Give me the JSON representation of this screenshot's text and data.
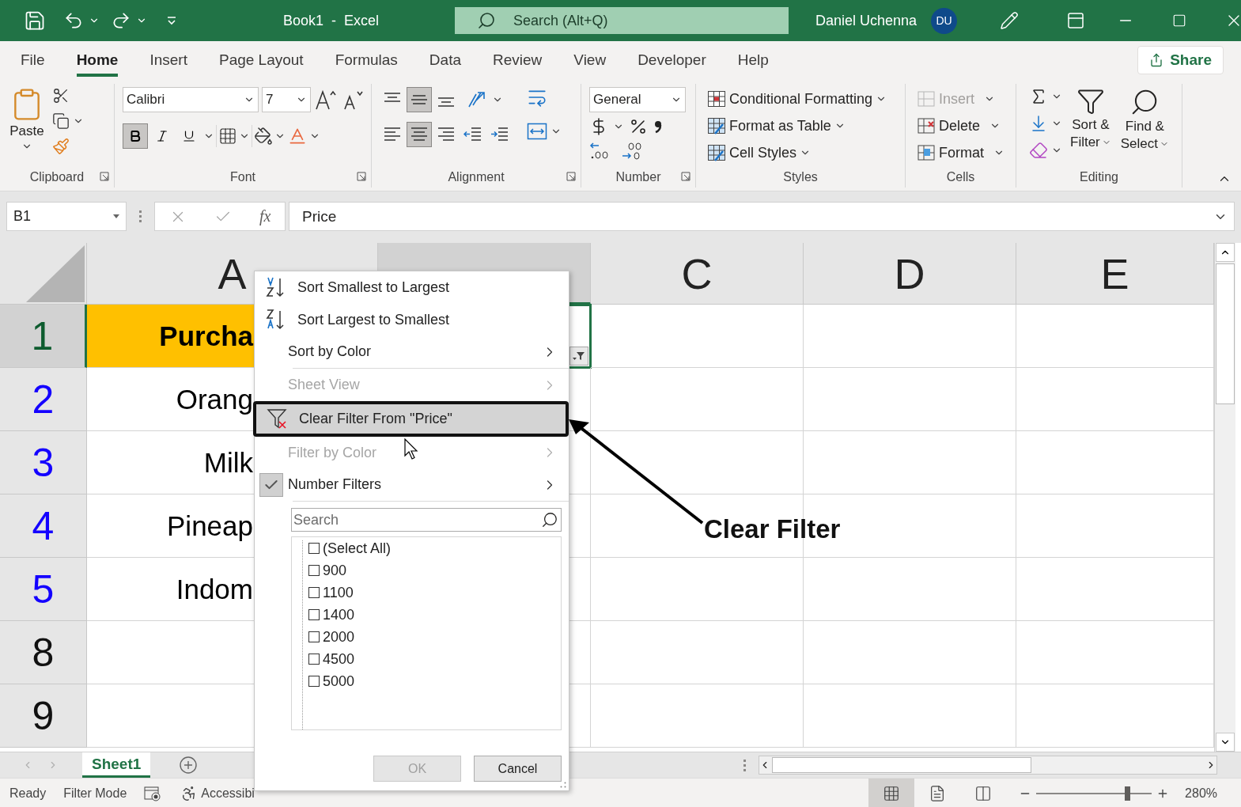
{
  "title_bar": {
    "title": "Book1  -  Excel",
    "search_placeholder": "Search (Alt+Q)",
    "user": "Daniel Uchenna",
    "avatar": "DU"
  },
  "tabs": [
    {
      "label": "File",
      "selected": false
    },
    {
      "label": "Home",
      "selected": true
    },
    {
      "label": "Insert",
      "selected": false
    },
    {
      "label": "Page Layout",
      "selected": false
    },
    {
      "label": "Formulas",
      "selected": false
    },
    {
      "label": "Data",
      "selected": false
    },
    {
      "label": "Review",
      "selected": false
    },
    {
      "label": "View",
      "selected": false
    },
    {
      "label": "Developer",
      "selected": false
    },
    {
      "label": "Help",
      "selected": false
    }
  ],
  "share": "Share",
  "ribbon": {
    "clipboard": {
      "paste": "Paste",
      "label": "Clipboard"
    },
    "font": {
      "name": "Calibri",
      "size": "7",
      "label": "Font",
      "bold": true,
      "italic": false,
      "underline": false
    },
    "alignment": {
      "label": "Alignment",
      "rows": [
        [
          {
            "kind": "top",
            "selected": false
          },
          {
            "kind": "middle",
            "selected": true
          },
          {
            "kind": "bottom",
            "selected": false
          }
        ],
        [
          {
            "kind": "left",
            "selected": false
          },
          {
            "kind": "center",
            "selected": true
          },
          {
            "kind": "right",
            "selected": false
          },
          {
            "kind": "indent_decrease",
            "selected": false
          },
          {
            "kind": "indent_increase",
            "selected": false
          }
        ]
      ]
    },
    "number": {
      "format": "General",
      "label": "Number"
    },
    "styles": {
      "label": "Styles",
      "items": [
        "Conditional Formatting",
        "Format as Table",
        "Cell Styles"
      ]
    },
    "cells": {
      "label": "Cells",
      "items": [
        {
          "label": "Insert",
          "disabled": true
        },
        {
          "label": "Delete",
          "disabled": false
        },
        {
          "label": "Format",
          "disabled": false
        }
      ]
    },
    "editing": {
      "label": "Editing",
      "sort": [
        "Sort &",
        "Filter"
      ],
      "find": [
        "Find &",
        "Select"
      ]
    }
  },
  "formula_bar": {
    "name_box": "B1",
    "fx": "fx",
    "value": "Price"
  },
  "sheet": {
    "columns": [
      {
        "label": "A",
        "selected": false
      },
      {
        "selected": true
      },
      {
        "label": "C",
        "selected": false
      },
      {
        "label": "D",
        "selected": false
      },
      {
        "label": "E",
        "selected": false
      }
    ],
    "rows": [
      {
        "header": "1",
        "selected": true,
        "filtered": false,
        "kind": "heading",
        "cell": "Purcha"
      },
      {
        "header": "2",
        "selected": false,
        "filtered": true,
        "kind": "data",
        "cell": "Orang"
      },
      {
        "header": "3",
        "selected": false,
        "filtered": true,
        "kind": "data",
        "cell": "Milk"
      },
      {
        "header": "4",
        "selected": false,
        "filtered": true,
        "kind": "data",
        "cell": "Pineap"
      },
      {
        "header": "5",
        "selected": false,
        "filtered": true,
        "kind": "data",
        "cell": "Indom"
      },
      {
        "header": "8",
        "selected": false,
        "filtered": false,
        "kind": "data"
      },
      {
        "header": "9",
        "selected": false,
        "filtered": false,
        "kind": "data"
      }
    ]
  },
  "filter_menu": {
    "items": [
      {
        "kind": "sort_ascending",
        "label": "Sort Smallest to Largest",
        "disabled": false
      },
      {
        "kind": "sort_descending",
        "label": "Sort Largest to Smallest",
        "disabled": false
      },
      {
        "kind": "submenu",
        "label": "Sort by Color",
        "disabled": false,
        "checked": false
      },
      {
        "kind": "separator"
      },
      {
        "kind": "submenu",
        "label": "Sheet View",
        "disabled": true,
        "checked": false
      },
      {
        "kind": "clear_filter",
        "label": "Clear Filter From \"Price\"",
        "disabled": false,
        "highlighted": true
      },
      {
        "kind": "submenu",
        "label": "Filter by Color",
        "disabled": true,
        "checked": false
      },
      {
        "kind": "submenu",
        "label": "Number Filters",
        "disabled": false,
        "checked": true
      },
      {
        "kind": "separator"
      }
    ],
    "search_placeholder": "Search",
    "values": [
      {
        "label": "(Select All)",
        "checked": false
      },
      {
        "label": "900",
        "checked": false
      },
      {
        "label": "1100",
        "checked": false
      },
      {
        "label": "1400",
        "checked": false
      },
      {
        "label": "2000",
        "checked": false
      },
      {
        "label": "4500",
        "checked": false
      },
      {
        "label": "5000",
        "checked": false
      }
    ],
    "ok": {
      "label": "OK",
      "disabled": true
    },
    "cancel": "Cancel"
  },
  "annotation": {
    "label": "Clear Filter"
  },
  "sheet_tabs": [
    {
      "label": "Sheet1",
      "selected": true
    }
  ],
  "status_bar": {
    "ready": "Ready",
    "filter_mode": "Filter Mode",
    "accessibility": "Accessibi",
    "views": [
      {
        "kind": "normal",
        "selected": true
      },
      {
        "kind": "page_layout",
        "selected": false
      },
      {
        "kind": "page_break",
        "selected": false
      }
    ],
    "zoom": {
      "level": 0.79,
      "reading": "280%"
    }
  }
}
